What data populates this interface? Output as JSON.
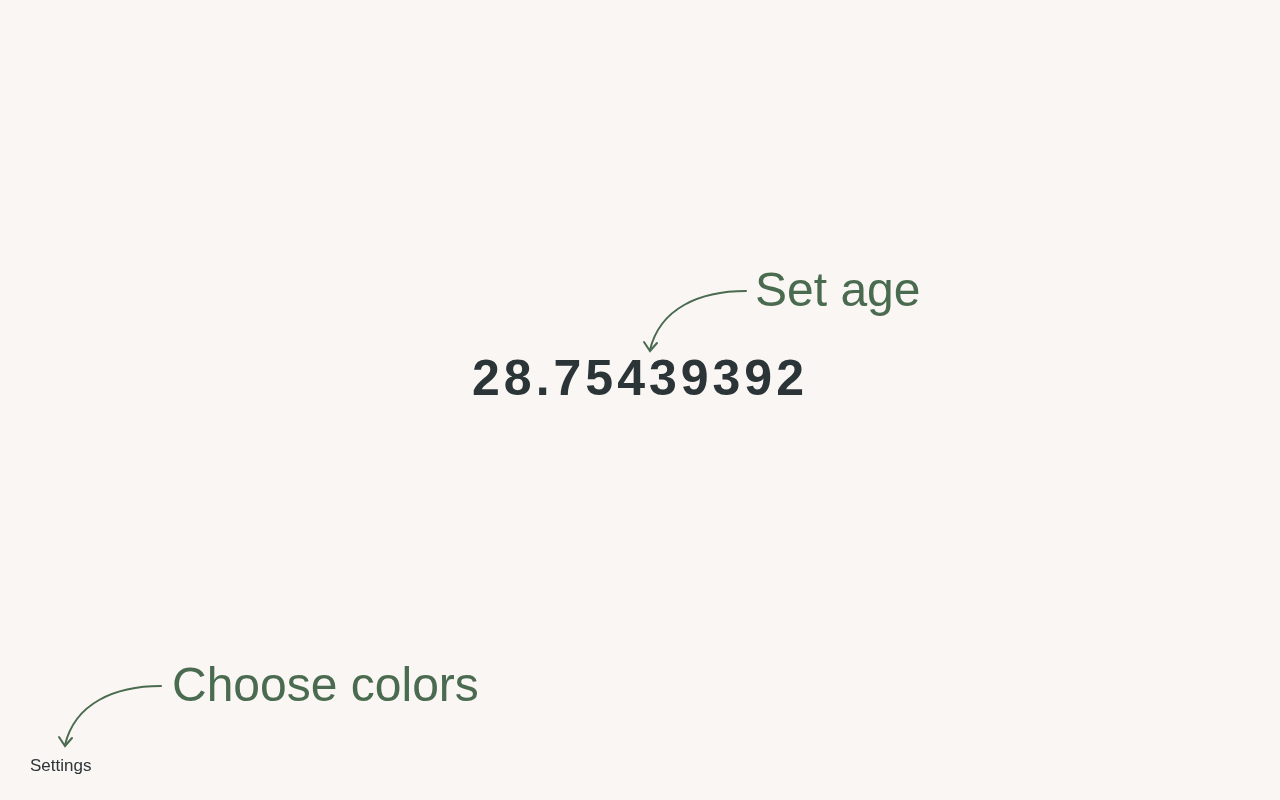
{
  "age": {
    "value": "28.75439392",
    "annotation": "Set age"
  },
  "settings": {
    "label": "Settings",
    "annotation": "Choose colors"
  }
}
